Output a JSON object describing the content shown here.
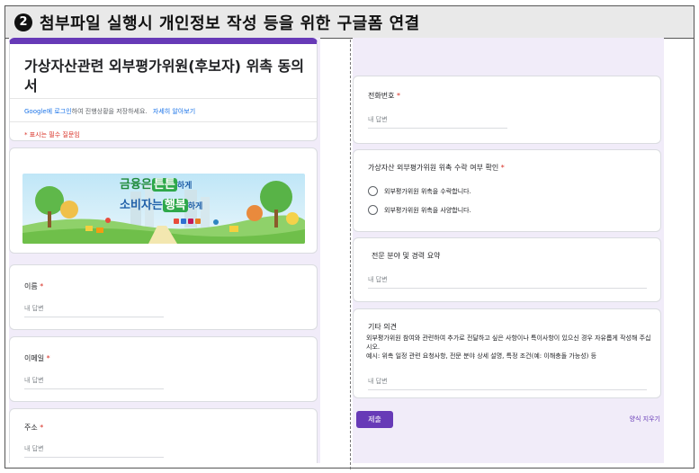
{
  "header": {
    "number": "2",
    "text": "첨부파일 실행시 개인정보 작성 등을 위한 구글폼 연결"
  },
  "form": {
    "title": "가상자산관련 외부평가위원(후보자) 위촉 동의서",
    "login_link": "Google에 로그인",
    "login_text": "하여 진행상황을 저장하세요.",
    "learn_more": "자세히 알아보기",
    "required_note": "* 표시는 필수 질문임",
    "banner": {
      "line1_a": "금융은",
      "line1_b": "튼튼",
      "line1_c": "하게",
      "line2_a": "소비자는",
      "line2_b": "행복",
      "line2_c": "하게"
    },
    "placeholder": "내 답변",
    "req_mark": "*"
  },
  "left_questions": {
    "name": "이름",
    "email": "이메일",
    "address": "주소"
  },
  "right_questions": {
    "phone": "전화번호",
    "accept": {
      "label": "가상자산 외부평가위원 위촉 수락 여부 확인",
      "option_yes": "외부평가위원 위촉을 수락합니다.",
      "option_no": "외부평가위원 위촉을 사양합니다."
    },
    "expertise": "전문 분야 및 경력 요약",
    "other": {
      "label": "기타 의견",
      "desc_line1": "외부평가위원 참여와 관련하여 추가로 전달하고 싶은 사항이나 특이사항이 있으신 경우 자유롭게 작성해 주십시오.",
      "desc_line2": "예시: 위촉 일정 관련 요청사항, 전문 분야 상세 설명, 특정 조건(예: 이해충돌 가능성) 등"
    }
  },
  "actions": {
    "submit": "제출",
    "clear": "양식 지우기"
  },
  "colors": {
    "accent": "#673ab7",
    "required": "#d93025",
    "link": "#1a73e8",
    "background": "#f1ecf9"
  }
}
